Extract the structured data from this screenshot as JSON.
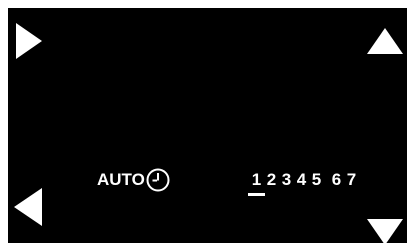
{
  "controls": {
    "right_icon": "triangle-right-icon",
    "left_icon": "triangle-left-icon",
    "up_icon": "triangle-up-icon",
    "down_icon": "triangle-down-icon"
  },
  "mode": {
    "label": "AUTO",
    "icon": "clock-icon"
  },
  "days": {
    "items": [
      "1",
      "2",
      "3",
      "4",
      "5",
      "6",
      "7"
    ],
    "selected": "1"
  },
  "colors": {
    "background": "#000000",
    "foreground": "#ffffff",
    "frame": "#ffffff"
  }
}
